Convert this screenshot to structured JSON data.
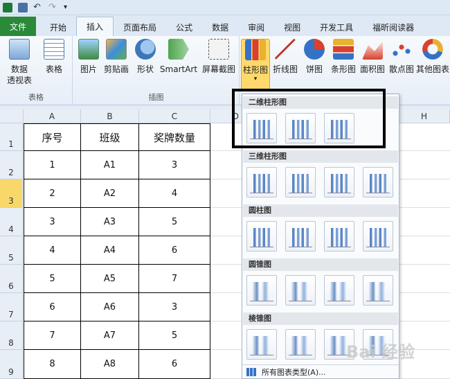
{
  "tabs": [
    "文件",
    "开始",
    "插入",
    "页面布局",
    "公式",
    "数据",
    "审阅",
    "视图",
    "开发工具",
    "福昕阅读器"
  ],
  "ribbon": {
    "buttons": [
      {
        "label": "数据\n透视表",
        "name": "pivot-table-button"
      },
      {
        "label": "表格",
        "name": "table-button"
      },
      {
        "label": "图片",
        "name": "picture-button"
      },
      {
        "label": "剪贴画",
        "name": "clipart-button"
      },
      {
        "label": "形状",
        "name": "shapes-button"
      },
      {
        "label": "SmartArt",
        "name": "smartart-button"
      },
      {
        "label": "屏幕截图",
        "name": "screenshot-button"
      },
      {
        "label": "柱形图",
        "name": "column-chart-button"
      },
      {
        "label": "折线图",
        "name": "line-chart-button"
      },
      {
        "label": "饼图",
        "name": "pie-chart-button"
      },
      {
        "label": "条形图",
        "name": "bar-chart-button"
      },
      {
        "label": "面积图",
        "name": "area-chart-button"
      },
      {
        "label": "散点图",
        "name": "scatter-chart-button"
      },
      {
        "label": "其他图表",
        "name": "other-chart-button"
      }
    ],
    "group_labels": [
      "表格",
      "插图"
    ]
  },
  "columns": [
    "A",
    "B",
    "C",
    "D",
    "H"
  ],
  "rows": [
    "1",
    "2",
    "3",
    "4",
    "5",
    "6",
    "7",
    "8",
    "9"
  ],
  "table": {
    "headers": [
      "序号",
      "班级",
      "奖牌数量"
    ],
    "rows": [
      [
        "1",
        "A1",
        "3"
      ],
      [
        "2",
        "A2",
        "4"
      ],
      [
        "3",
        "A3",
        "5"
      ],
      [
        "4",
        "A4",
        "6"
      ],
      [
        "5",
        "A5",
        "7"
      ],
      [
        "6",
        "A6",
        "3"
      ],
      [
        "7",
        "A7",
        "5"
      ],
      [
        "8",
        "A8",
        "6"
      ]
    ]
  },
  "gallery": {
    "sections": [
      "二维柱形图",
      "三维柱形图",
      "圆柱图",
      "圆锥图",
      "棱锥图"
    ],
    "all_charts": "所有图表类型(A)..."
  },
  "watermark": "Bai 经验"
}
